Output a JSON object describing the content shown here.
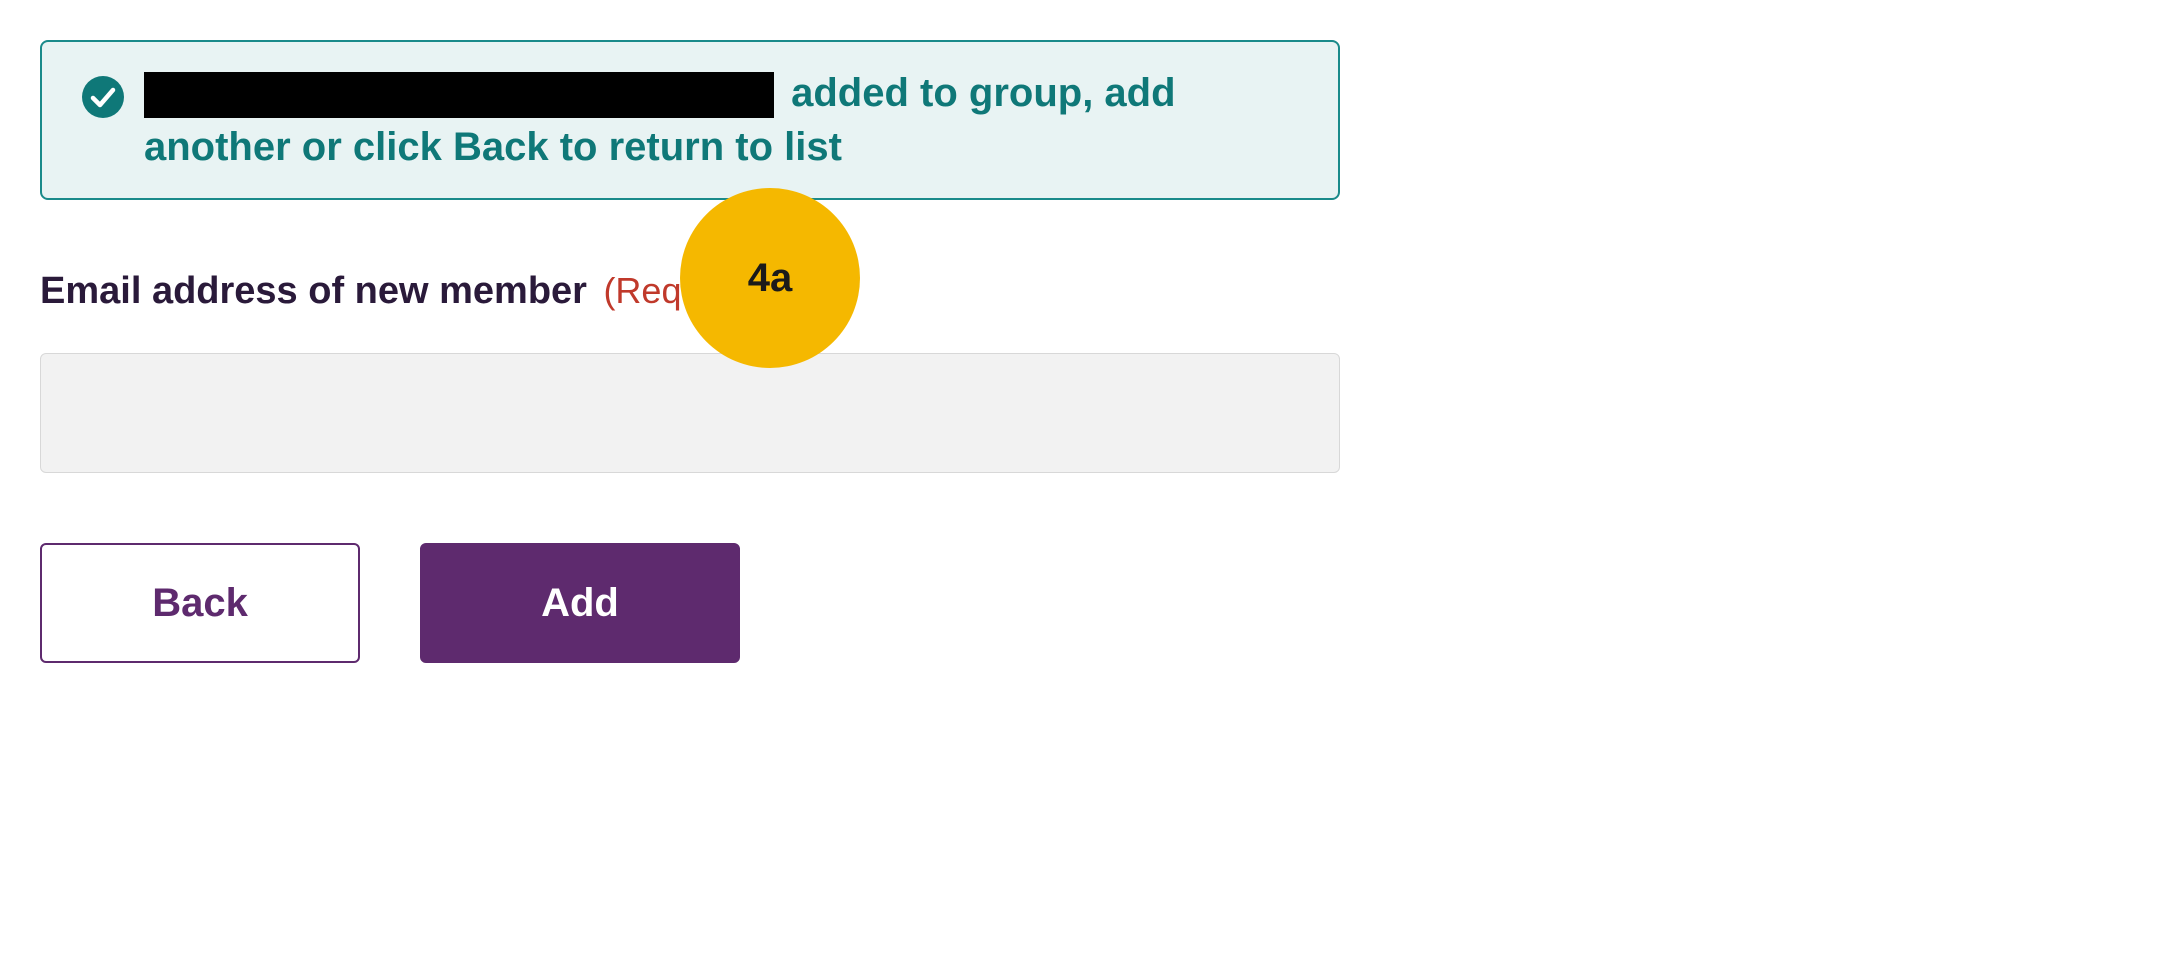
{
  "alert": {
    "redacted": true,
    "message_suffix": " added to group, add another or click Back to return to list"
  },
  "form": {
    "email_label": "Email address of new member",
    "required_label": "(Required)",
    "email_value": ""
  },
  "annotation": {
    "badge_text": "4a"
  },
  "buttons": {
    "back_label": "Back",
    "add_label": "Add"
  },
  "colors": {
    "teal": "#0f7878",
    "teal_border": "#1a8a8a",
    "teal_bg": "#e8f3f3",
    "purple": "#5e2a6e",
    "required_red": "#c0392b",
    "badge_yellow": "#f5b800",
    "input_bg": "#f2f2f2"
  }
}
